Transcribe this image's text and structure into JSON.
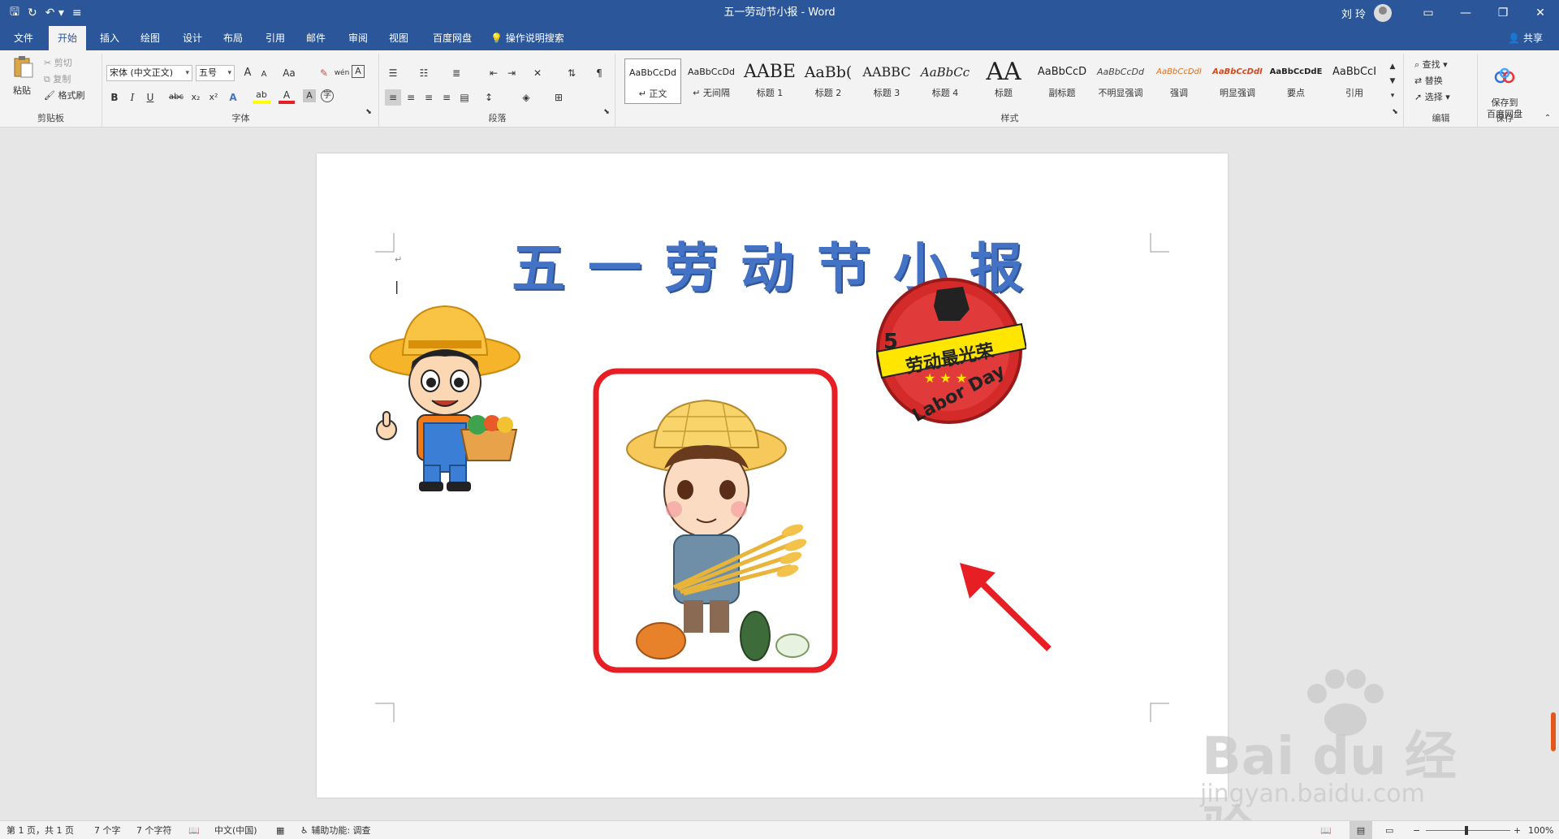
{
  "window": {
    "title": "五一劳动节小报  -  Word",
    "user": "刘 玲",
    "ribbon_display_icon": "ribbon-display-icon",
    "minimize_icon": "minimize-icon",
    "restore_icon": "restore-icon",
    "close_icon": "close-icon"
  },
  "qat": {
    "save_icon": "save-icon",
    "redo_icon": "redo-icon",
    "undo_icon": "undo-icon",
    "customize_icon": "customize-icon"
  },
  "tabs": [
    {
      "label": "文件"
    },
    {
      "label": "开始"
    },
    {
      "label": "插入"
    },
    {
      "label": "绘图"
    },
    {
      "label": "设计"
    },
    {
      "label": "布局"
    },
    {
      "label": "引用"
    },
    {
      "label": "邮件"
    },
    {
      "label": "审阅"
    },
    {
      "label": "视图"
    },
    {
      "label": "百度网盘"
    }
  ],
  "tell_me": "操作说明搜索",
  "share": "共享",
  "clipboard": {
    "paste": "粘贴",
    "cut": "剪切",
    "copy": "复制",
    "format_painter": "格式刷",
    "label": "剪贴板"
  },
  "font": {
    "name": "宋体 (中文正文)",
    "size": "五号",
    "label": "字体",
    "grow": "A",
    "shrink": "A",
    "case": "Aa",
    "bold": "B",
    "italic": "I",
    "underline": "U",
    "strike": "abc",
    "sub": "x₂",
    "sup": "x²",
    "highlight": "ab",
    "color": "A",
    "shading": "A"
  },
  "paragraph": {
    "label": "段落"
  },
  "styles": {
    "label": "样式",
    "items": [
      {
        "preview": "AaBbCcDd",
        "name": "↵ 正文"
      },
      {
        "preview": "AaBbCcDd",
        "name": "↵ 无间隔"
      },
      {
        "preview": "AABE",
        "name": "标题 1"
      },
      {
        "preview": "AaBb(",
        "name": "标题 2"
      },
      {
        "preview": "AABBC",
        "name": "标题 3"
      },
      {
        "preview": "AaBbCc",
        "name": "标题 4"
      },
      {
        "preview": "AA",
        "name": "标题"
      },
      {
        "preview": "AaBbCcD",
        "name": "副标题"
      },
      {
        "preview": "AaBbCcDd",
        "name": "不明显强调"
      },
      {
        "preview": "AaBbCcDdI",
        "name": "强调"
      },
      {
        "preview": "AaBbCcDdI",
        "name": "明显强调"
      },
      {
        "preview": "AaBbCcDdE",
        "name": "要点"
      },
      {
        "preview": "AaBbCcI",
        "name": "引用"
      }
    ]
  },
  "editing": {
    "find": "查找",
    "replace": "替换",
    "select": "选择",
    "label": "编辑"
  },
  "save_group": {
    "button": "保存到\n百度网盘",
    "label": "保存"
  },
  "document": {
    "title": "五一劳动节小报",
    "badge_top": "5",
    "badge_band": "劳动最光荣",
    "badge_bottom": "Labor Day"
  },
  "status": {
    "page": "第 1 页，共 1 页",
    "words": "7 个字",
    "chars": "7 个字符",
    "lang": "中文(中国)",
    "accessibility": "辅助功能: 调查",
    "zoom": "100%"
  },
  "watermark": {
    "text": "Bai du 经验",
    "sub": "jingyan.baidu.com"
  },
  "colors": {
    "title_bar": "#2b579a",
    "title_text": "#4472c4",
    "highlight_box": "#e81e25"
  }
}
